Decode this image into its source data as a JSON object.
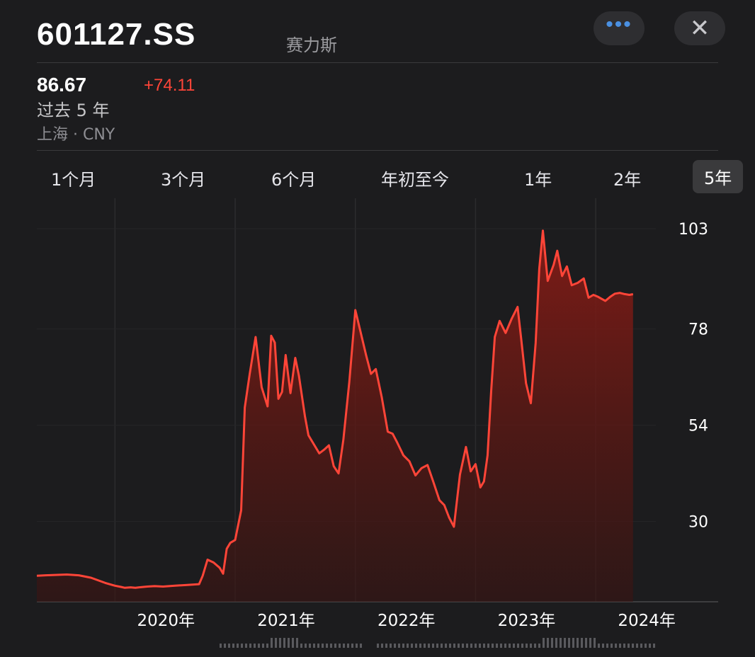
{
  "header": {
    "ticker": "601127.SS",
    "company": "赛力斯",
    "more_icon": "ellipsis-icon",
    "close_icon": "close-icon",
    "accent": "#4a90e2"
  },
  "quote": {
    "price": "86.67",
    "change": "+74.11",
    "period": "过去 5 年",
    "exchange": "上海 · CNY",
    "change_color": "#ff4538"
  },
  "tabs": [
    {
      "label": "1个月",
      "active": false
    },
    {
      "label": "3个月",
      "active": false
    },
    {
      "label": "6个月",
      "active": false
    },
    {
      "label": "年初至今",
      "active": false
    },
    {
      "label": "1年",
      "active": false
    },
    {
      "label": "2年",
      "active": false
    },
    {
      "label": "5年",
      "active": true
    }
  ],
  "chart_data": {
    "type": "area",
    "line_color": "#ff4538",
    "grid": true,
    "y_tick_labels": [
      "103",
      "78",
      "54",
      "30"
    ],
    "y_tick_values": [
      103,
      78,
      54,
      30
    ],
    "x_tick_labels": [
      "2020年",
      "2021年",
      "2022年",
      "2023年",
      "2024年"
    ],
    "x_tick_values": [
      2020.0,
      2021.0,
      2022.0,
      2023.0,
      2024.0
    ],
    "xlim": [
      2019.35,
      2024.5
    ],
    "ylim": [
      10,
      106
    ],
    "series": [
      {
        "x": [
          2019.35,
          2019.42,
          2019.52,
          2019.6,
          2019.7,
          2019.8,
          2019.92,
          2020.0,
          2020.05,
          2020.08,
          2020.13,
          2020.17,
          2020.2,
          2020.27,
          2020.33,
          2020.4,
          2020.5,
          2020.6,
          2020.7,
          2020.73,
          2020.77,
          2020.82,
          2020.87,
          2020.9,
          2020.93,
          2020.96,
          2021.0,
          2021.05,
          2021.08,
          2021.12,
          2021.17,
          2021.22,
          2021.27,
          2021.3,
          2021.33,
          2021.36,
          2021.39,
          2021.42,
          2021.46,
          2021.5,
          2021.53,
          2021.58,
          2021.61,
          2021.66,
          2021.7,
          2021.74,
          2021.78,
          2021.82,
          2021.86,
          2021.9,
          2021.95,
          2022.0,
          2022.04,
          2022.09,
          2022.13,
          2022.17,
          2022.22,
          2022.27,
          2022.31,
          2022.35,
          2022.4,
          2022.45,
          2022.5,
          2022.55,
          2022.6,
          2022.65,
          2022.7,
          2022.74,
          2022.78,
          2022.82,
          2022.87,
          2022.92,
          2022.96,
          2023.0,
          2023.04,
          2023.07,
          2023.1,
          2023.13,
          2023.16,
          2023.2,
          2023.25,
          2023.3,
          2023.35,
          2023.38,
          2023.42,
          2023.46,
          2023.5,
          2023.53,
          2023.56,
          2023.6,
          2023.65,
          2023.68,
          2023.72,
          2023.76,
          2023.8,
          2023.85,
          2023.9,
          2023.94,
          2023.98,
          2024.02,
          2024.05,
          2024.08,
          2024.12,
          2024.16,
          2024.2,
          2024.24,
          2024.28,
          2024.31
        ],
        "y": [
          16.5,
          16.6,
          16.7,
          16.8,
          16.6,
          16.0,
          14.7,
          14.0,
          13.7,
          13.5,
          13.6,
          13.5,
          13.6,
          13.8,
          13.9,
          13.8,
          14.0,
          14.2,
          14.4,
          16.5,
          20.5,
          19.8,
          18.5,
          17.0,
          23.2,
          24.7,
          25.4,
          32.8,
          58.4,
          66.6,
          76.0,
          63.5,
          58.7,
          76.3,
          74.6,
          60.6,
          62.3,
          71.5,
          62.0,
          70.8,
          66.4,
          56.3,
          51.5,
          49.0,
          47.0,
          47.9,
          49.0,
          43.8,
          42.0,
          50.4,
          64.8,
          82.7,
          77.7,
          71.4,
          66.8,
          68.0,
          60.9,
          52.4,
          51.9,
          49.6,
          46.5,
          45.0,
          41.5,
          43.3,
          44.1,
          39.8,
          35.3,
          34.1,
          31.0,
          28.7,
          41.7,
          48.6,
          42.5,
          44.3,
          38.5,
          40.0,
          46.5,
          62.5,
          76.0,
          80.0,
          77.0,
          80.5,
          83.5,
          75.5,
          64.5,
          59.5,
          74.5,
          93.0,
          102.5,
          90.0,
          94.0,
          97.5,
          91.2,
          93.6,
          88.9,
          89.5,
          90.6,
          85.8,
          86.5,
          86.0,
          85.5,
          85.0,
          86.0,
          86.8,
          87.0,
          86.7,
          86.5,
          86.67
        ]
      }
    ]
  }
}
